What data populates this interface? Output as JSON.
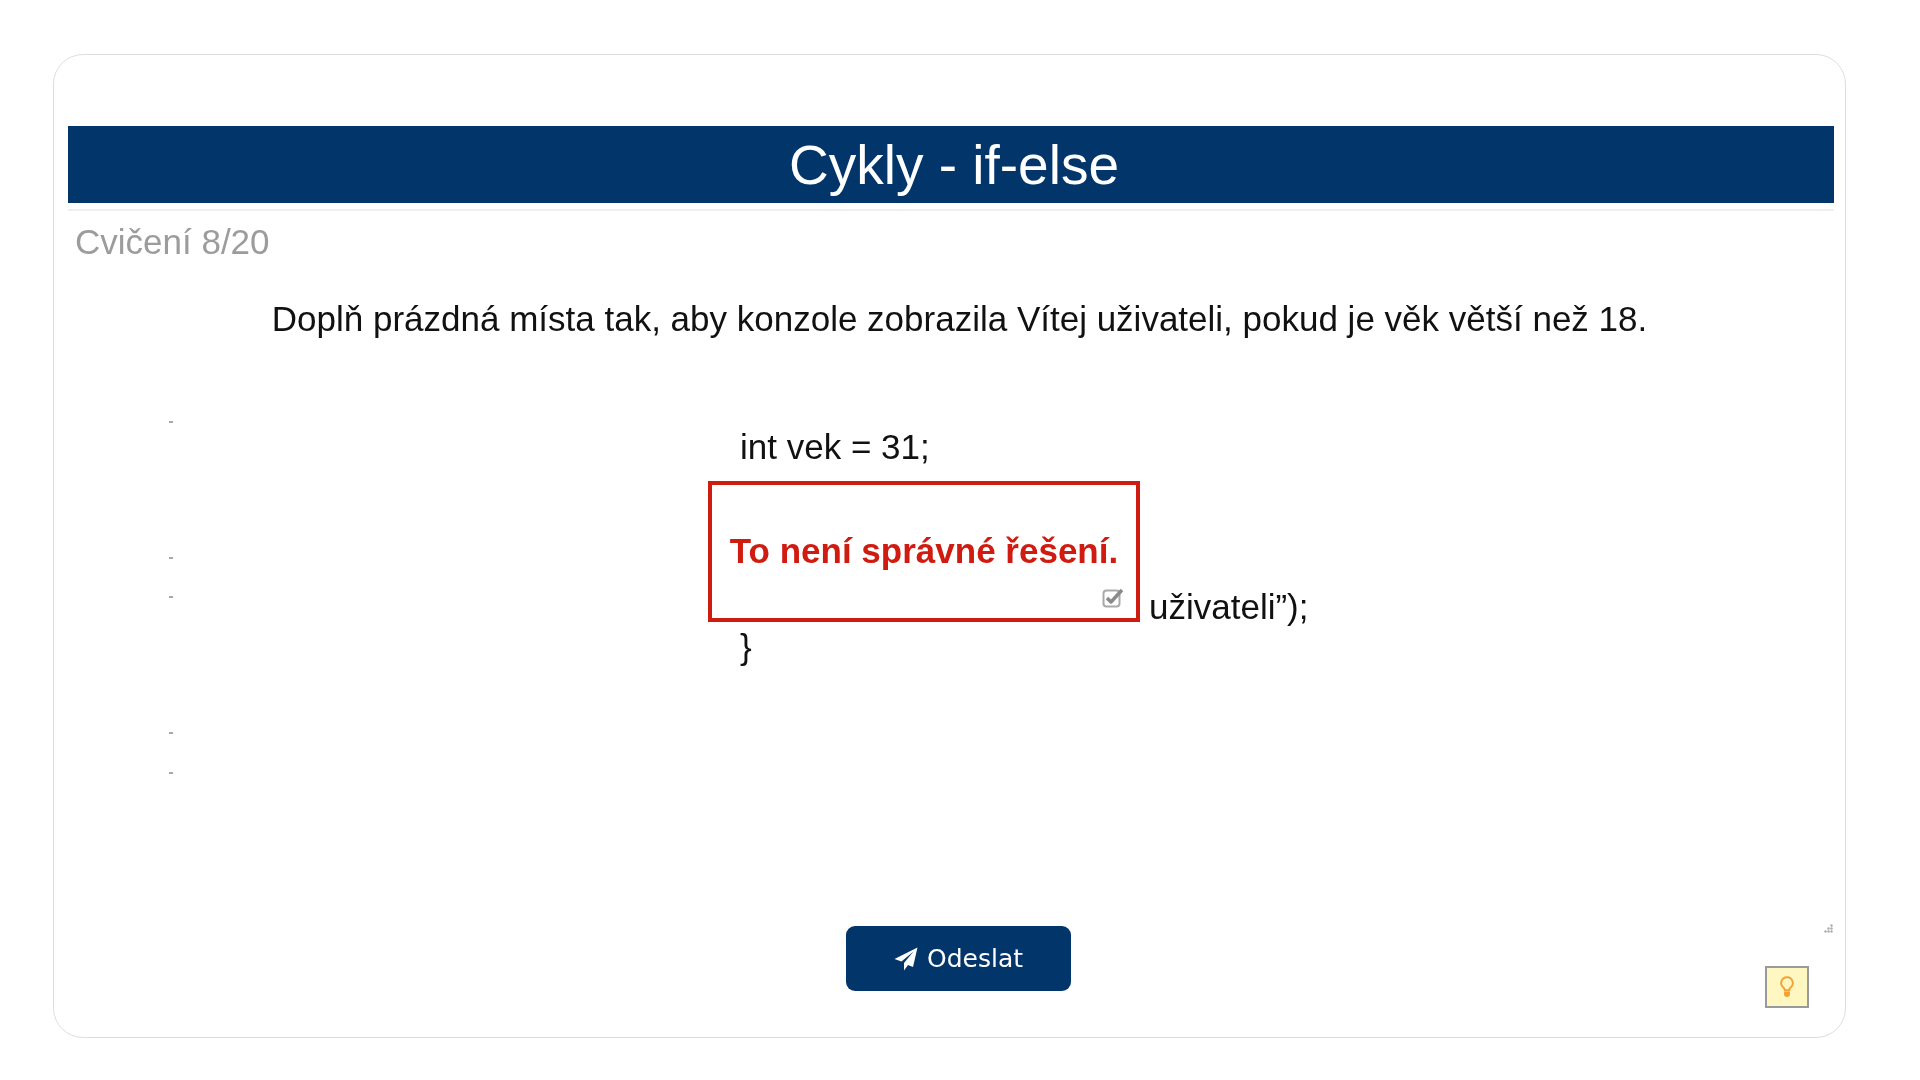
{
  "header": {
    "title": "Cykly - if-else"
  },
  "progress": "Cvičení 8/20",
  "instruction": "Doplň prázdná místa tak, aby konzole zobrazila Vítej uživateli, pokud je věk větší než 18.",
  "code": {
    "lines": [
      {
        "kind": "line",
        "text": "int vek = 31;"
      },
      {
        "kind": "tail",
        "text": "uživateli”);"
      },
      {
        "kind": "line",
        "text": "}"
      }
    ]
  },
  "feedback": {
    "message": "To není správné řešení."
  },
  "submit_button": {
    "label": "Odeslat"
  }
}
